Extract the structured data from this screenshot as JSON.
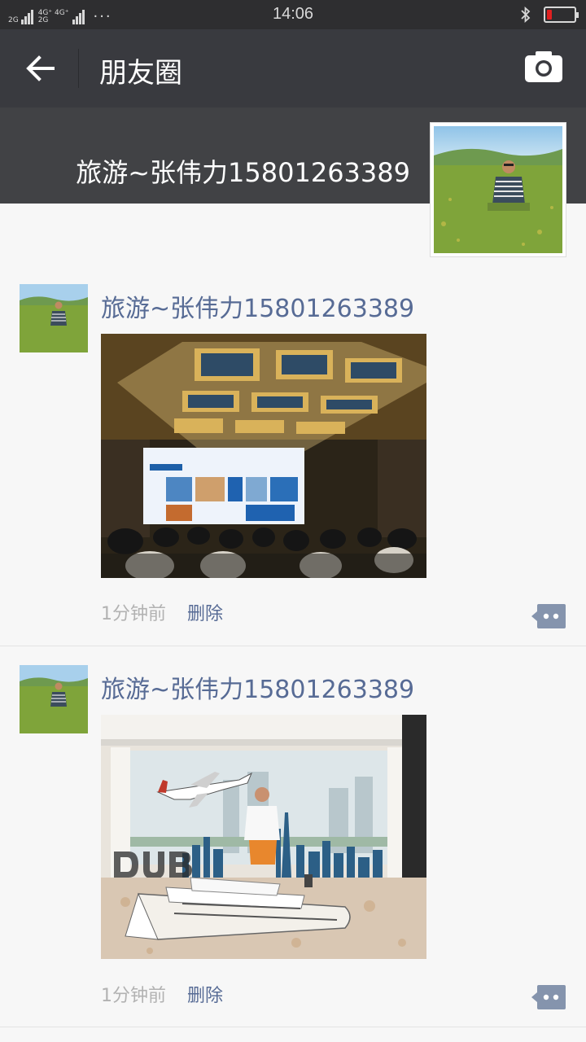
{
  "status_bar": {
    "sim1": "2G",
    "sim2_top": "4G⁺ 4G⁺",
    "sim2_bottom": "2G",
    "more": "···",
    "time": "14:06"
  },
  "header": {
    "title": "朋友圈"
  },
  "cover": {
    "name": "旅游~张伟力15801263389"
  },
  "posts": [
    {
      "author": "旅游~张伟力15801263389",
      "time": "1分钟前",
      "delete_label": "删除"
    },
    {
      "author": "旅游~张伟力15801263389",
      "time": "1分钟前",
      "delete_label": "删除"
    }
  ],
  "colors": {
    "status_bar_bg": "#2e2e30",
    "title_bar_bg": "#393a3f",
    "cover_bg": "#414245",
    "link_blue": "#576b95",
    "meta_gray": "#b2b2b2",
    "battery_low": "#e02020"
  },
  "battery_level": 0.2
}
